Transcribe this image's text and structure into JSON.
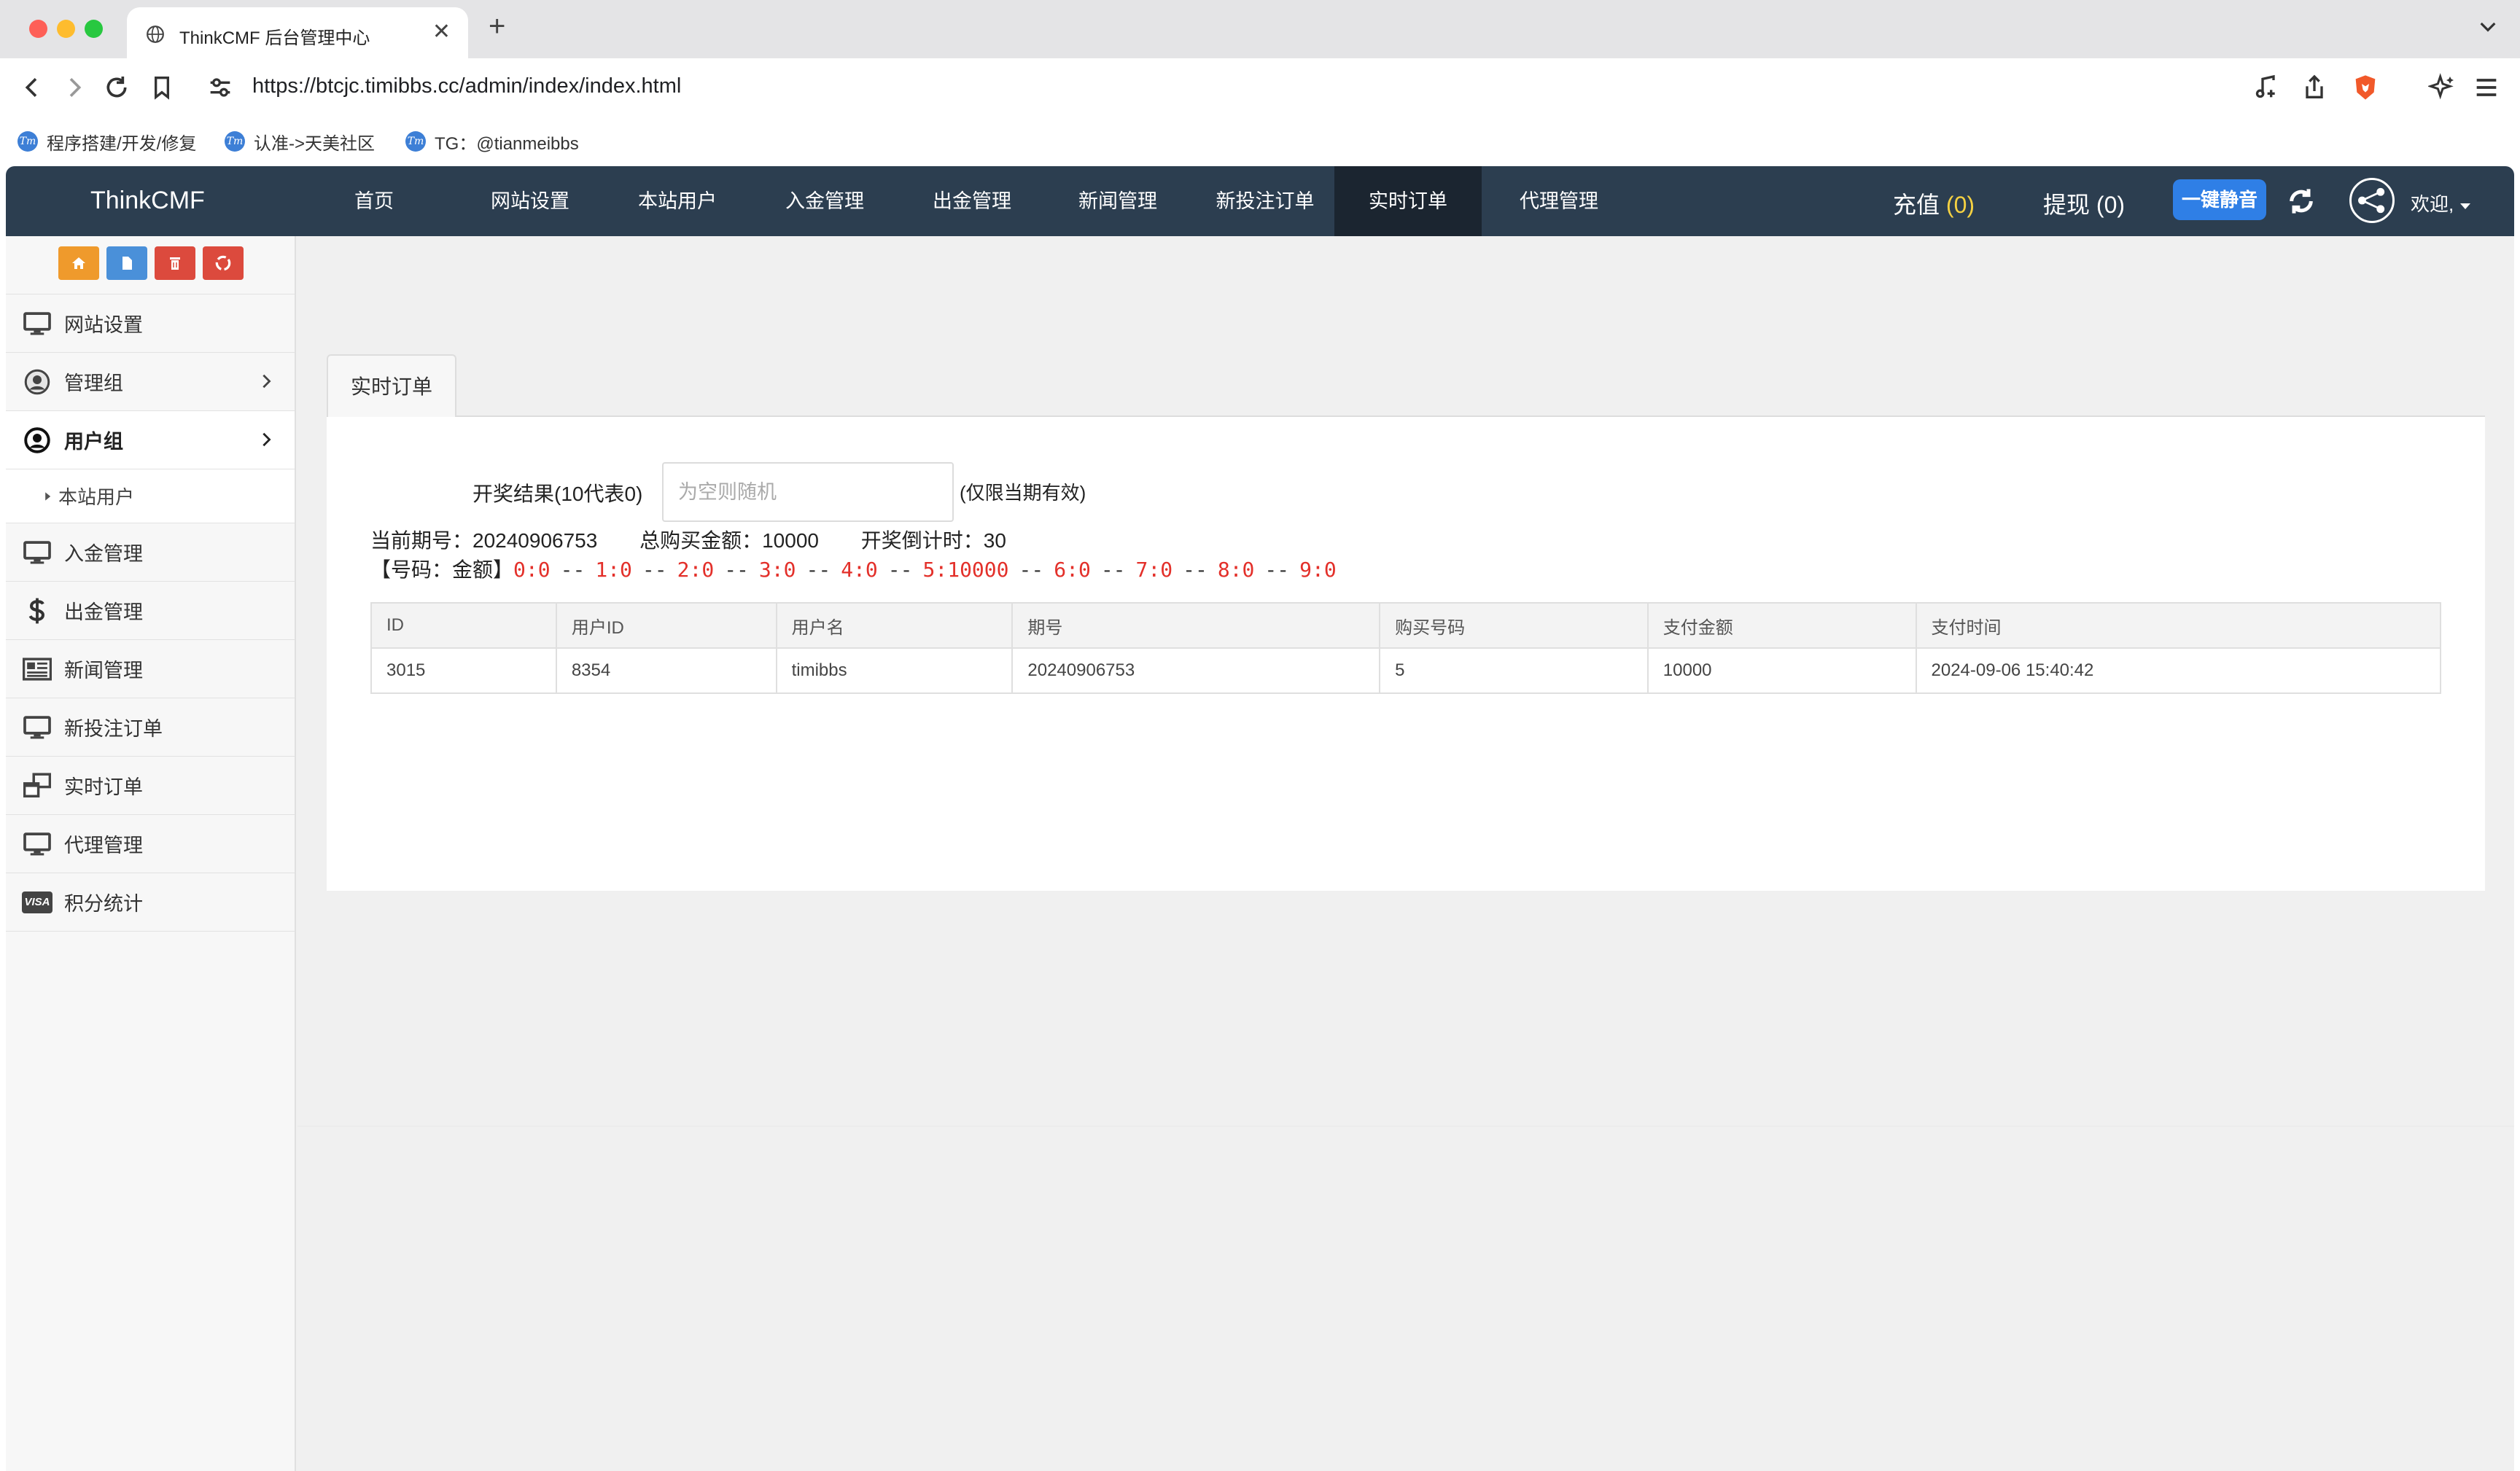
{
  "browser": {
    "tab_title": "ThinkCMF 后台管理中心",
    "close_glyph": "✕",
    "new_tab_glyph": "+",
    "url": "https://btcjc.timibbs.cc/admin/index/index.html",
    "bookmarks": [
      {
        "label": "程序搭建/开发/修复"
      },
      {
        "label": "认准->天美社区"
      },
      {
        "label": "TG：@tianmeibbs"
      }
    ]
  },
  "topnav": {
    "brand": "ThinkCMF",
    "items": [
      {
        "label": "首页"
      },
      {
        "label": "网站设置"
      },
      {
        "label": "本站用户"
      },
      {
        "label": "入金管理"
      },
      {
        "label": "出金管理"
      },
      {
        "label": "新闻管理"
      },
      {
        "label": "新投注订单"
      },
      {
        "label": "实时订单"
      },
      {
        "label": "代理管理"
      }
    ],
    "recharge_label": "充值",
    "recharge_count": "(0)",
    "withdraw_label": "提现",
    "withdraw_count": "(0)",
    "mute_label": "一键静音",
    "welcome": "欢迎,"
  },
  "sidebar": {
    "items": [
      {
        "label": "网站设置"
      },
      {
        "label": "管理组"
      },
      {
        "label": "用户组"
      },
      {
        "label": "入金管理"
      },
      {
        "label": "出金管理"
      },
      {
        "label": "新闻管理"
      },
      {
        "label": "新投注订单"
      },
      {
        "label": "实时订单"
      },
      {
        "label": "代理管理"
      },
      {
        "label": "积分统计"
      }
    ],
    "sub_item": "本站用户",
    "visa_text": "VISA"
  },
  "content": {
    "tab_label": "实时订单",
    "result_label": "开奖结果(10代表0)",
    "result_placeholder": "为空则随机",
    "result_hint": "(仅限当期有效)",
    "period_label": "当前期号：",
    "period_value": "20240906753",
    "total_label": "总购买金额：",
    "total_value": "10000",
    "countdown_label": "开奖倒计时：",
    "countdown_value": "30",
    "odds_prefix": "【号码：金额】",
    "odds_separator": "--",
    "odds": [
      "0:0",
      "1:0",
      "2:0",
      "3:0",
      "4:0",
      "5:10000",
      "6:0",
      "7:0",
      "8:0",
      "9:0"
    ],
    "table": {
      "headers": [
        "ID",
        "用户ID",
        "用户名",
        "期号",
        "购买号码",
        "支付金额",
        "支付时间"
      ],
      "rows": [
        [
          "3015",
          "8354",
          "timibbs",
          "20240906753",
          "5",
          "10000",
          "2024-09-06 15:40:42"
        ]
      ]
    }
  },
  "colors": {
    "nav_bg": "#2c3e50",
    "nav_active": "#1b2530",
    "accent_blue": "#2f7fe6",
    "odds_red": "#e3302a",
    "count_yellow": "#f5d142"
  }
}
